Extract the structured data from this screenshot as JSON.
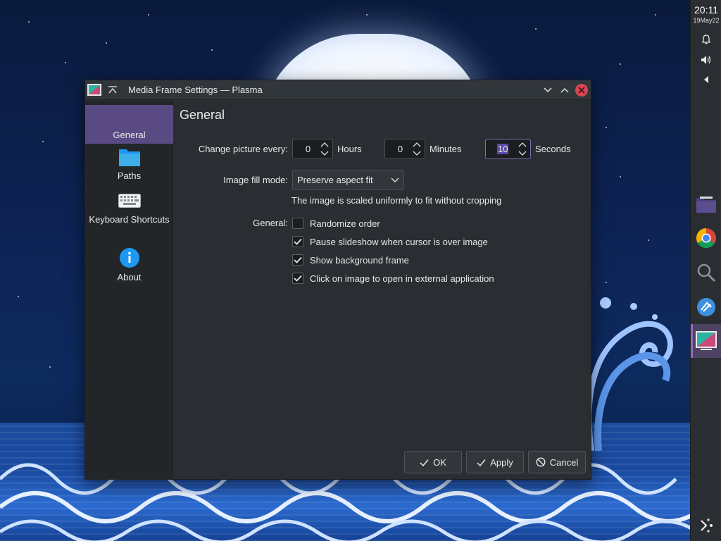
{
  "panel": {
    "time": "20:11",
    "date": "19May22",
    "tray_icons": [
      "bell-icon",
      "volume-icon",
      "expand-tray-icon"
    ],
    "tasks": [
      "file-manager-icon",
      "chrome-icon",
      "search-icon",
      "discover-icon",
      "media-frame-settings-icon"
    ],
    "bottom_icon": "kde-connect-icon"
  },
  "window": {
    "title": "Media Frame Settings — Plasma",
    "buttons": [
      "minimize",
      "maximize",
      "close"
    ]
  },
  "sidebar": {
    "items": [
      {
        "label": "General",
        "icon": "general-icon",
        "active": true
      },
      {
        "label": "Paths",
        "icon": "folder-icon",
        "active": false
      },
      {
        "label": "Keyboard Shortcuts",
        "icon": "keyboard-icon",
        "active": false
      },
      {
        "label": "About",
        "icon": "info-icon",
        "active": false
      }
    ]
  },
  "page": {
    "title": "General",
    "change_picture_label": "Change picture every:",
    "hours_value": "0",
    "hours_unit": "Hours",
    "minutes_value": "0",
    "minutes_unit": "Minutes",
    "seconds_value": "10",
    "seconds_unit": "Seconds",
    "fill_mode_label": "Image fill mode:",
    "fill_mode_value": "Preserve aspect fit",
    "fill_mode_hint": "The image is scaled uniformly to fit without cropping",
    "general_label": "General:",
    "options": [
      {
        "label": "Randomize order",
        "checked": false
      },
      {
        "label": "Pause slideshow when cursor is over image",
        "checked": true
      },
      {
        "label": "Show background frame",
        "checked": true
      },
      {
        "label": "Click on image to open in external application",
        "checked": true
      }
    ]
  },
  "buttons": {
    "ok": "OK",
    "apply": "Apply",
    "cancel": "Cancel"
  },
  "colors": {
    "accent": "#5a4a84",
    "window_bg": "#2a2e32",
    "close_button": "#da4453"
  }
}
